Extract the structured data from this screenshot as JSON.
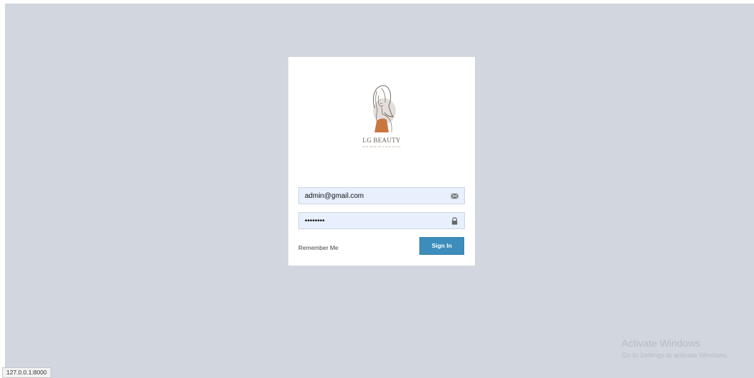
{
  "brand": {
    "name": "LG BEAUTY",
    "tagline": "SKIN MAKE UP & HAIR STYLE",
    "colors": {
      "accent": "#c9773e",
      "blob": "#e3dedb",
      "line": "#6b5b52"
    }
  },
  "login": {
    "email_value": "admin@gmail.com",
    "password_value": "••••••••",
    "remember_label": "Remember Me",
    "signin_label": "Sign In",
    "email_icon": "envelope-icon",
    "password_icon": "lock-icon"
  },
  "colors": {
    "page_background": "#d2d6de",
    "box_background": "#ffffff",
    "field_background": "#e8f0fe",
    "button": "#3c8dbc"
  },
  "watermark": {
    "title": "Activate Windows",
    "subtitle": "Go to Settings to activate Windows."
  },
  "status_bar": {
    "url": "127.0.0.1:8000"
  }
}
